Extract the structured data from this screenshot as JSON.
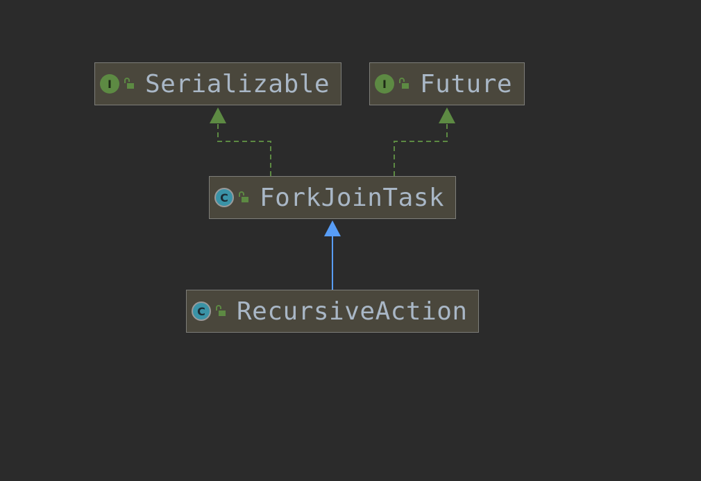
{
  "diagram": {
    "nodes": {
      "serializable": {
        "label": "Serializable",
        "kind_icon": "interface-icon",
        "kind_glyph": "I",
        "visibility_icon": "public-lock-icon"
      },
      "future": {
        "label": "Future",
        "kind_icon": "interface-icon",
        "kind_glyph": "I",
        "visibility_icon": "public-lock-icon"
      },
      "forkjointask": {
        "label": "ForkJoinTask",
        "kind_icon": "abstract-class-icon",
        "kind_glyph": "C",
        "visibility_icon": "public-lock-icon"
      },
      "recursiveaction": {
        "label": "RecursiveAction",
        "kind_icon": "abstract-class-icon",
        "kind_glyph": "C",
        "visibility_icon": "public-lock-icon"
      }
    },
    "edges": [
      {
        "from": "ForkJoinTask",
        "to": "Serializable",
        "type": "implements"
      },
      {
        "from": "ForkJoinTask",
        "to": "Future",
        "type": "implements"
      },
      {
        "from": "RecursiveAction",
        "to": "ForkJoinTask",
        "type": "extends"
      }
    ]
  },
  "colors": {
    "background": "#2b2b2b",
    "node_fill": "#4a473c",
    "node_border": "#7e7e7a",
    "label": "#a9b7c6",
    "implements_edge": "#5d8a43",
    "extends_edge": "#589df6",
    "interface_badge": "#5d8a43",
    "class_badge": "#3a93a7"
  }
}
